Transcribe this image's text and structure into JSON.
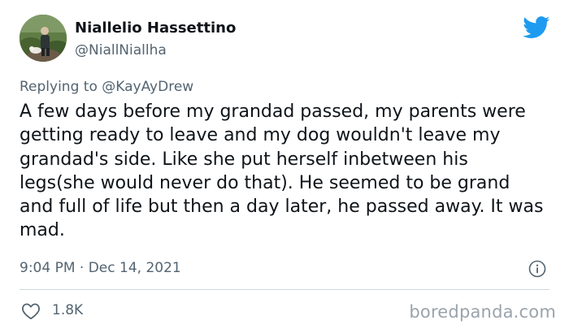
{
  "author": {
    "display_name": "Niallelio Hassettino",
    "handle": "@NiallNiallha",
    "avatar_icon": "profile-photo"
  },
  "reply": {
    "prefix": "Replying to ",
    "mention": "@KayAyDrew"
  },
  "tweet": {
    "text": "A few days before my grandad passed, my parents were getting ready to leave and my dog wouldn't leave my grandad's side. Like she put herself inbetween his legs(she would never do that). He seemed to be grand and full of life but then a day later, he passed away. It was mad.",
    "timestamp": "9:04 PM · Dec 14, 2021"
  },
  "actions": {
    "like_count": "1.8K",
    "like_icon": "heart-icon",
    "info_icon": "info-icon"
  },
  "branding": {
    "platform_icon": "twitter-bird-icon",
    "watermark": "boredpanda.com"
  },
  "colors": {
    "twitter_blue": "#1d9bf0",
    "text_primary": "#0f1419",
    "text_secondary": "#536471",
    "divider": "#cfd9de"
  }
}
